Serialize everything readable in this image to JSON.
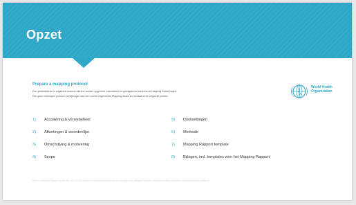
{
  "slide": {
    "title": "Opzet",
    "subtitle": "Prepare a mapping protocol",
    "intro_lines": [
      "Een gedetailleerd en uitgebred protocol dient te worden opgesteld, beoordeeld en goedgekeurd alvorens de Mapping Studie begint.",
      "Een goed ontworpen protocol zal bijdragen aan een correct uitgevoerde Mapping Studie en bestaat uit de volgende punten:"
    ],
    "logo": {
      "icon": "who-emblem-icon",
      "line1": "World Health",
      "line2": "Organization"
    },
    "left_items": [
      {
        "num": "1)",
        "text": "Accodering & versiebeheer"
      },
      {
        "num": "2)",
        "text": "Afkortingen & woordenlijst"
      },
      {
        "num": "3)",
        "text": "Omschrijving & motivering"
      },
      {
        "num": "4)",
        "text": "Scope"
      }
    ],
    "right_items": [
      {
        "num": "5)",
        "text": "Doelstellingen"
      },
      {
        "num": "6)",
        "text": "Methode"
      },
      {
        "num": "7)",
        "text": "Mapping Rapport template"
      },
      {
        "num": "8)",
        "text": "Bijlagen, incl. templates voor het Mapping Rapport"
      }
    ],
    "footer": "WHO Technical Report Series No. 961 (2011) Annex 9: Model guidance for the storage and transport of time- and temperature-sensitive pharmaceutical products"
  },
  "colors": {
    "accent": "#2fa7c8",
    "background": "#e9e9e9",
    "text": "#333333"
  }
}
